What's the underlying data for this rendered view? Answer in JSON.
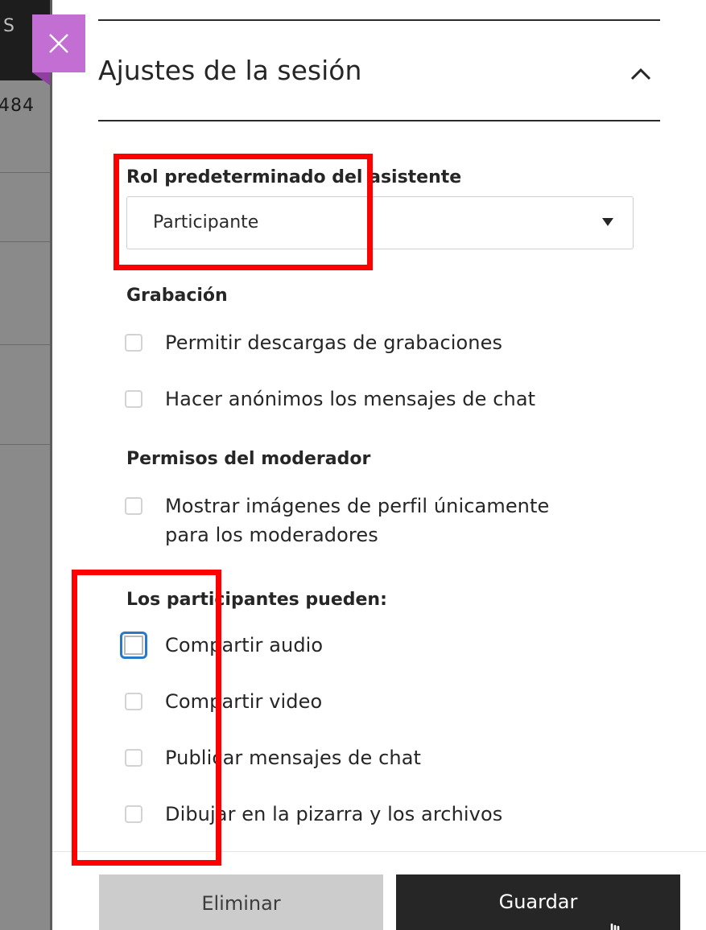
{
  "background": {
    "topbar_text": "S",
    "number_fragment": "484"
  },
  "panel": {
    "title": "Ajustes de la sesión",
    "default_role": {
      "label": "Rol predeterminado del asistente",
      "selected": "Participante"
    },
    "recording": {
      "heading": "Grabación",
      "options": [
        "Permitir descargas de grabaciones",
        "Hacer anónimos los mensajes de chat"
      ]
    },
    "moderator": {
      "heading": "Permisos del moderador",
      "option_line1": "Mostrar imágenes de perfil únicamente",
      "option_line2": "para los moderadores"
    },
    "participants": {
      "heading": "Los participantes pueden:",
      "options": [
        "Compartir audio",
        "Compartir video",
        "Publicar mensajes de chat",
        "Dibujar en la pizarra y los archivos"
      ]
    },
    "buttons": {
      "delete": "Eliminar",
      "save": "Guardar"
    }
  },
  "colors": {
    "close_button": "#c26ed2",
    "save_button": "#262626",
    "delete_button": "#cccccc",
    "focus_ring": "#2a79c8",
    "annotation": "#ff0000"
  },
  "icons": [
    "close-icon",
    "chevron-up-icon",
    "dropdown-caret-icon",
    "hand-cursor-icon"
  ]
}
